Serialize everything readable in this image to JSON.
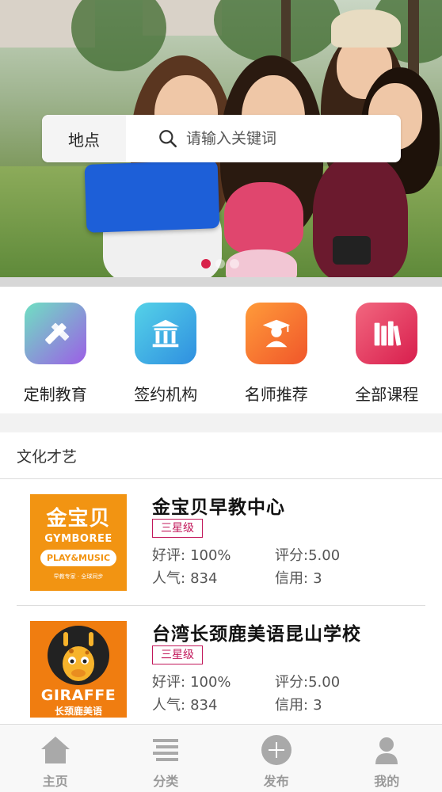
{
  "search": {
    "location_label": "地点",
    "placeholder": "请输入关键词"
  },
  "banner": {
    "dots_total": 3,
    "active_dot": 1
  },
  "categories": [
    {
      "label": "定制教育",
      "icon": "pencil-ruler-icon",
      "color_from": "#6fe0c2",
      "color_to": "#9c5ee6"
    },
    {
      "label": "签约机构",
      "icon": "institution-icon",
      "color_from": "#55d2e8",
      "color_to": "#2f8fe0"
    },
    {
      "label": "名师推荐",
      "icon": "teacher-icon",
      "color_from": "#ff9b3a",
      "color_to": "#f0562a"
    },
    {
      "label": "全部课程",
      "icon": "books-icon",
      "color_from": "#f2677f",
      "color_to": "#d81e4d"
    }
  ],
  "section": {
    "title": "文化才艺",
    "items": [
      {
        "name": "金宝贝早教中心",
        "level": "三星级",
        "praise_label": "好评:",
        "praise_value": "100%",
        "score": "评分:5.00",
        "popularity_label": "人气:",
        "popularity_value": "834",
        "credit_label": "信用:",
        "credit_value": "3",
        "logo": {
          "cn": "金宝贝",
          "en": "GYMBOREE",
          "sub": "PLAY&MUSIC",
          "tag": "早教专家 · 全球同步"
        }
      },
      {
        "name": "台湾长颈鹿美语昆山学校",
        "level": "三星级",
        "praise_label": "好评:",
        "praise_value": "100%",
        "score": "评分:5.00",
        "popularity_label": "人气:",
        "popularity_value": "834",
        "credit_label": "信用:",
        "credit_value": "3",
        "logo": {
          "en": "GIRAFFE",
          "cn": "长颈鹿美语"
        }
      }
    ]
  },
  "tabbar": [
    {
      "label": "主页",
      "icon": "home-icon"
    },
    {
      "label": "分类",
      "icon": "list-icon"
    },
    {
      "label": "发布",
      "icon": "plus-circle-icon"
    },
    {
      "label": "我的",
      "icon": "user-icon"
    }
  ],
  "colors": {
    "accent": "#d8214a",
    "badge": "#c2185b",
    "tab_inactive": "#999999"
  }
}
